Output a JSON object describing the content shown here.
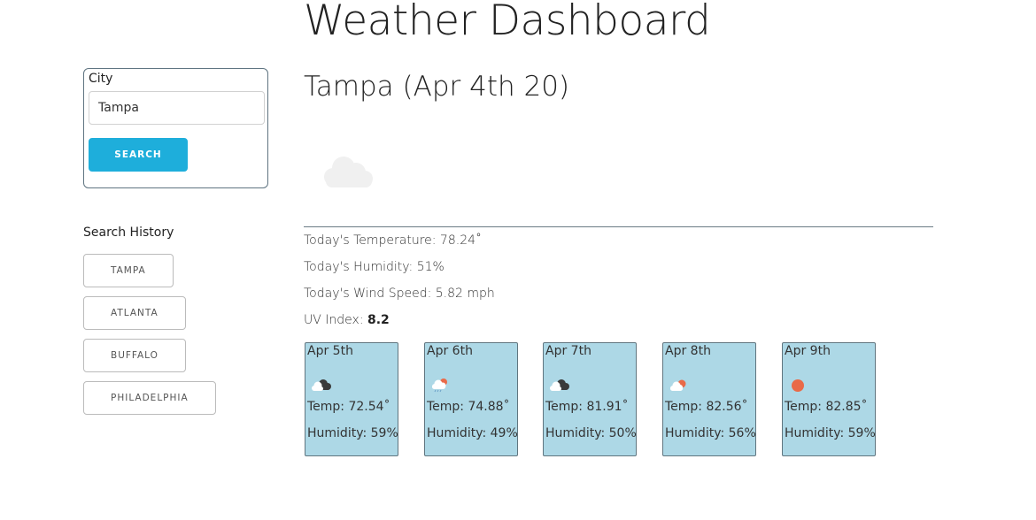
{
  "header": {
    "title": "Weather Dashboard"
  },
  "search": {
    "label": "City",
    "value": "Tampa",
    "button_label": "Search"
  },
  "history": {
    "title": "Search History",
    "items": [
      "Tampa",
      "Atlanta",
      "Buffalo",
      "Philadelphia"
    ]
  },
  "current": {
    "city_date": "Tampa (Apr 4th 20)",
    "icon": "cloud-icon",
    "temperature": "Today's Temperature: 78.24˚",
    "humidity": "Today's Humidity: 51%",
    "wind": "Today's Wind Speed: 5.82 mph",
    "uv_label": "UV Index: ",
    "uv_value": "8.2"
  },
  "forecast": [
    {
      "date": "Apr 5th",
      "icon": "broken-clouds-icon",
      "temp": "Temp: 72.54˚",
      "humidity": "Humidity: 59%"
    },
    {
      "date": "Apr 6th",
      "icon": "rain-icon",
      "temp": "Temp: 74.88˚",
      "humidity": "Humidity: 49%"
    },
    {
      "date": "Apr 7th",
      "icon": "broken-clouds-icon",
      "temp": "Temp: 81.91˚",
      "humidity": "Humidity: 50%"
    },
    {
      "date": "Apr 8th",
      "icon": "few-clouds-icon",
      "temp": "Temp: 82.56˚",
      "humidity": "Humidity: 56%"
    },
    {
      "date": "Apr 9th",
      "icon": "sun-icon",
      "temp": "Temp: 82.85˚",
      "humidity": "Humidity: 59%"
    }
  ],
  "colors": {
    "accent": "#1eaedb",
    "forecast_bg": "#add8e6",
    "sun": "#e96a48"
  }
}
